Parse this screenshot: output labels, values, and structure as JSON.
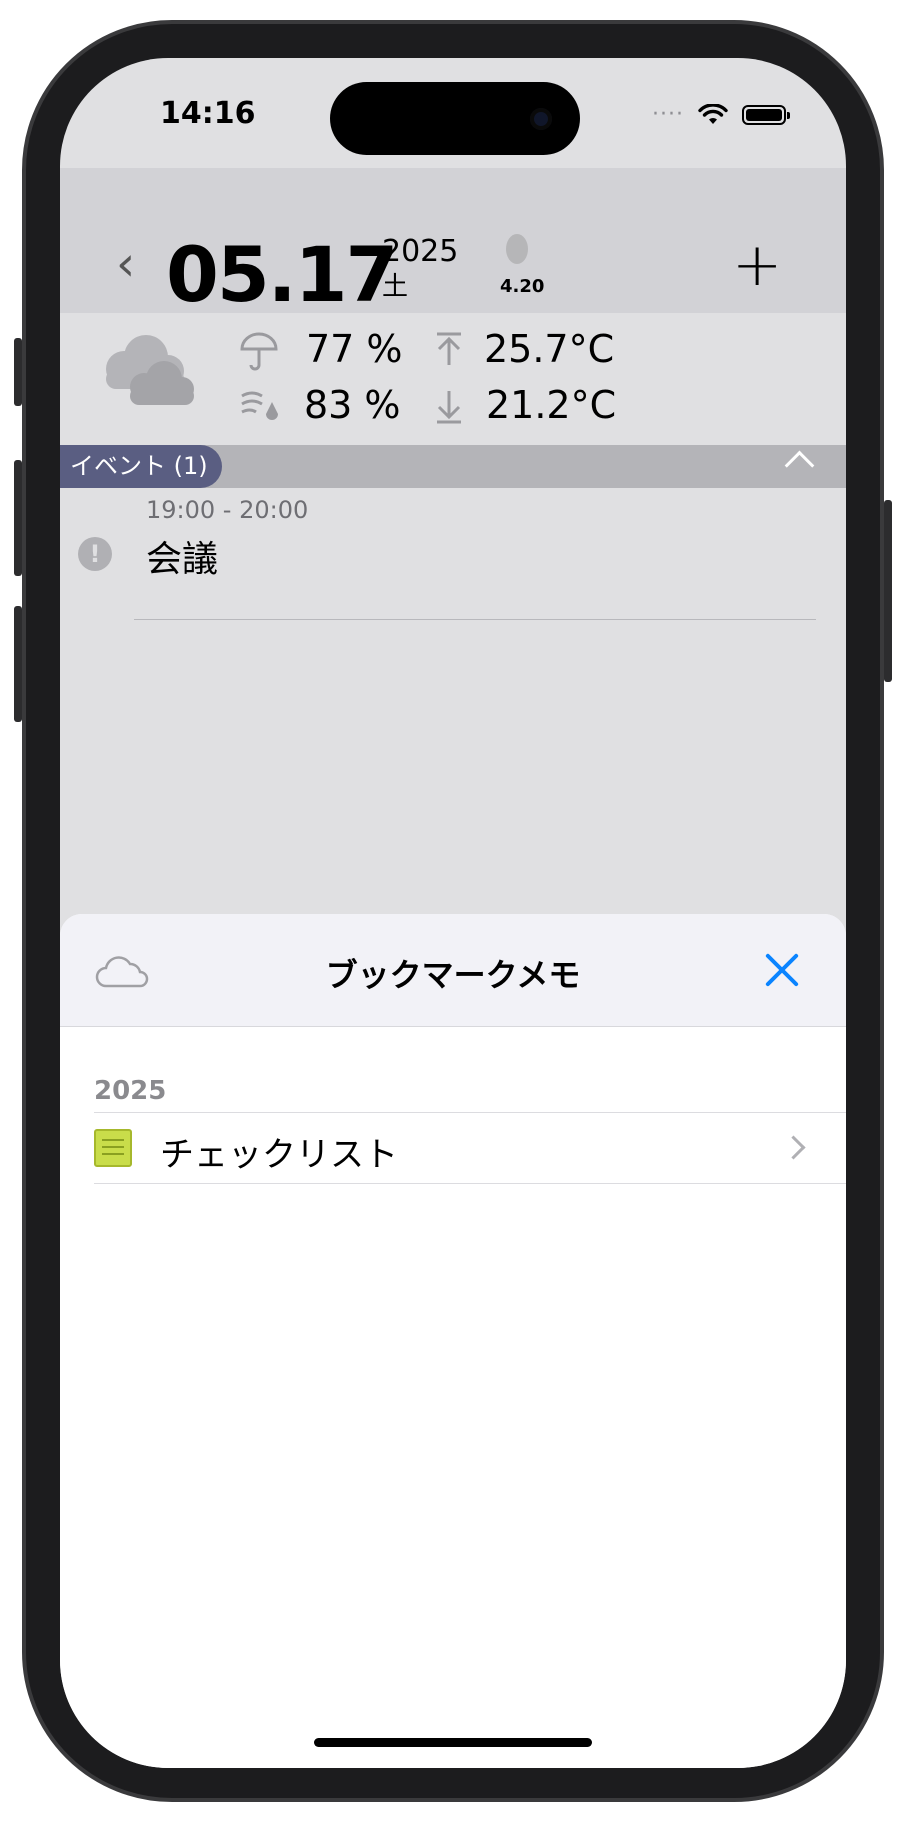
{
  "status": {
    "time": "14:16",
    "signal": "····"
  },
  "header": {
    "back": "‹",
    "date": "05.17",
    "year": "2025",
    "weekday": "土",
    "moon_age": "4.20",
    "add": "+"
  },
  "weather": {
    "precip": "77 %",
    "humidity": "83 %",
    "high": "25.7°C",
    "low": "21.2°C"
  },
  "events": {
    "tag": "イベント (1)",
    "items": [
      {
        "time": "19:00 - 20:00",
        "title": "会議"
      }
    ]
  },
  "sheet": {
    "title": "ブックマークメモ",
    "section": "2025",
    "rows": [
      {
        "label": "チェックリスト"
      }
    ]
  },
  "colors": {
    "accent": "#0a84ff",
    "event_tag": "#5a5e82",
    "note": "#c9dd4a"
  }
}
